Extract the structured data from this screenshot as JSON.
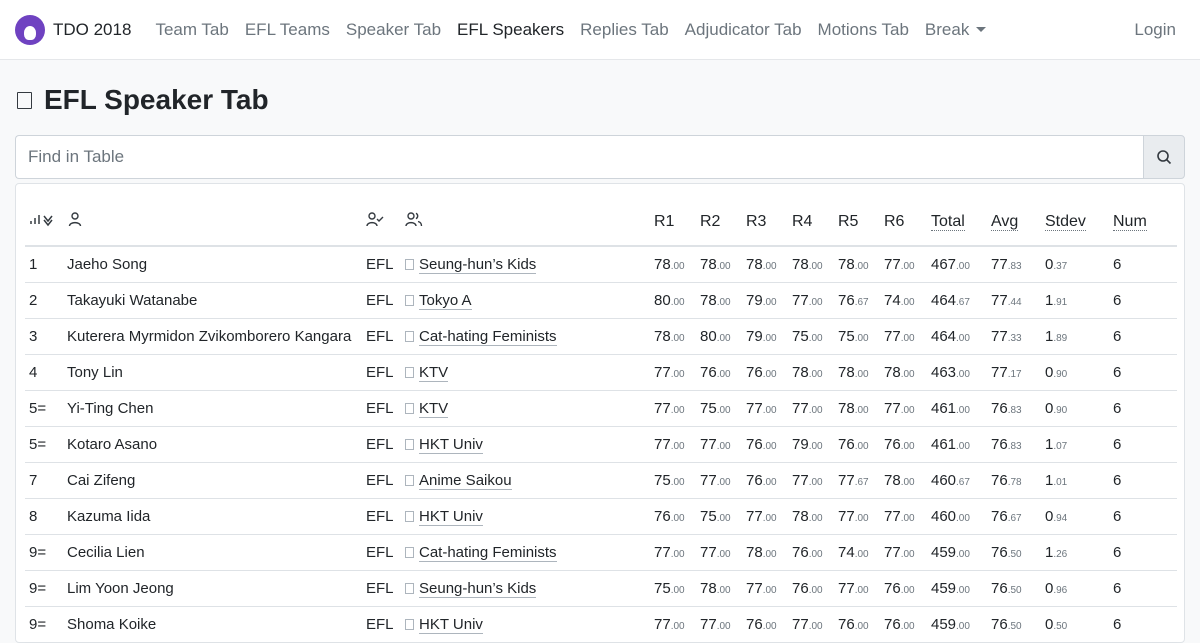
{
  "nav": {
    "brand": "TDO 2018",
    "items": [
      "Team Tab",
      "EFL Teams",
      "Speaker Tab",
      "EFL Speakers",
      "Replies Tab",
      "Adjudicator Tab",
      "Motions Tab",
      "Break"
    ],
    "active": "EFL Speakers",
    "login": "Login"
  },
  "page": {
    "title": "EFL Speaker Tab"
  },
  "search": {
    "placeholder": "Find in Table"
  },
  "table": {
    "headers": {
      "r1": "R1",
      "r2": "R2",
      "r3": "R3",
      "r4": "R4",
      "r5": "R5",
      "r6": "R6",
      "total": "Total",
      "avg": "Avg",
      "stdev": "Stdev",
      "num": "Num"
    },
    "rows": [
      {
        "rank": "1",
        "name": "Jaeho Song",
        "cat": "EFL",
        "team": "Seung-hun’s Kids",
        "scores": [
          [
            "78",
            ".00"
          ],
          [
            "78",
            ".00"
          ],
          [
            "78",
            ".00"
          ],
          [
            "78",
            ".00"
          ],
          [
            "78",
            ".00"
          ],
          [
            "77",
            ".00"
          ]
        ],
        "total": [
          "467",
          ".00"
        ],
        "avg": [
          "77",
          ".83"
        ],
        "stdev": [
          "0",
          ".37"
        ],
        "num": "6"
      },
      {
        "rank": "2",
        "name": "Takayuki Watanabe",
        "cat": "EFL",
        "team": "Tokyo A",
        "scores": [
          [
            "80",
            ".00"
          ],
          [
            "78",
            ".00"
          ],
          [
            "79",
            ".00"
          ],
          [
            "77",
            ".00"
          ],
          [
            "76",
            ".67"
          ],
          [
            "74",
            ".00"
          ]
        ],
        "total": [
          "464",
          ".67"
        ],
        "avg": [
          "77",
          ".44"
        ],
        "stdev": [
          "1",
          ".91"
        ],
        "num": "6"
      },
      {
        "rank": "3",
        "name": "Kuterera Myrmidon Zvikomborero Kangara",
        "cat": "EFL",
        "team": "Cat-hating Feminists",
        "scores": [
          [
            "78",
            ".00"
          ],
          [
            "80",
            ".00"
          ],
          [
            "79",
            ".00"
          ],
          [
            "75",
            ".00"
          ],
          [
            "75",
            ".00"
          ],
          [
            "77",
            ".00"
          ]
        ],
        "total": [
          "464",
          ".00"
        ],
        "avg": [
          "77",
          ".33"
        ],
        "stdev": [
          "1",
          ".89"
        ],
        "num": "6"
      },
      {
        "rank": "4",
        "name": "Tony Lin",
        "cat": "EFL",
        "team": "KTV",
        "scores": [
          [
            "77",
            ".00"
          ],
          [
            "76",
            ".00"
          ],
          [
            "76",
            ".00"
          ],
          [
            "78",
            ".00"
          ],
          [
            "78",
            ".00"
          ],
          [
            "78",
            ".00"
          ]
        ],
        "total": [
          "463",
          ".00"
        ],
        "avg": [
          "77",
          ".17"
        ],
        "stdev": [
          "0",
          ".90"
        ],
        "num": "6"
      },
      {
        "rank": "5=",
        "name": "Yi-Ting Chen",
        "cat": "EFL",
        "team": "KTV",
        "scores": [
          [
            "77",
            ".00"
          ],
          [
            "75",
            ".00"
          ],
          [
            "77",
            ".00"
          ],
          [
            "77",
            ".00"
          ],
          [
            "78",
            ".00"
          ],
          [
            "77",
            ".00"
          ]
        ],
        "total": [
          "461",
          ".00"
        ],
        "avg": [
          "76",
          ".83"
        ],
        "stdev": [
          "0",
          ".90"
        ],
        "num": "6"
      },
      {
        "rank": "5=",
        "name": "Kotaro Asano",
        "cat": "EFL",
        "team": "HKT Univ",
        "scores": [
          [
            "77",
            ".00"
          ],
          [
            "77",
            ".00"
          ],
          [
            "76",
            ".00"
          ],
          [
            "79",
            ".00"
          ],
          [
            "76",
            ".00"
          ],
          [
            "76",
            ".00"
          ]
        ],
        "total": [
          "461",
          ".00"
        ],
        "avg": [
          "76",
          ".83"
        ],
        "stdev": [
          "1",
          ".07"
        ],
        "num": "6"
      },
      {
        "rank": "7",
        "name": "Cai Zifeng",
        "cat": "EFL",
        "team": "Anime Saikou",
        "scores": [
          [
            "75",
            ".00"
          ],
          [
            "77",
            ".00"
          ],
          [
            "76",
            ".00"
          ],
          [
            "77",
            ".00"
          ],
          [
            "77",
            ".67"
          ],
          [
            "78",
            ".00"
          ]
        ],
        "total": [
          "460",
          ".67"
        ],
        "avg": [
          "76",
          ".78"
        ],
        "stdev": [
          "1",
          ".01"
        ],
        "num": "6"
      },
      {
        "rank": "8",
        "name": "Kazuma Iida",
        "cat": "EFL",
        "team": "HKT Univ",
        "scores": [
          [
            "76",
            ".00"
          ],
          [
            "75",
            ".00"
          ],
          [
            "77",
            ".00"
          ],
          [
            "78",
            ".00"
          ],
          [
            "77",
            ".00"
          ],
          [
            "77",
            ".00"
          ]
        ],
        "total": [
          "460",
          ".00"
        ],
        "avg": [
          "76",
          ".67"
        ],
        "stdev": [
          "0",
          ".94"
        ],
        "num": "6"
      },
      {
        "rank": "9=",
        "name": "Cecilia Lien",
        "cat": "EFL",
        "team": "Cat-hating Feminists",
        "scores": [
          [
            "77",
            ".00"
          ],
          [
            "77",
            ".00"
          ],
          [
            "78",
            ".00"
          ],
          [
            "76",
            ".00"
          ],
          [
            "74",
            ".00"
          ],
          [
            "77",
            ".00"
          ]
        ],
        "total": [
          "459",
          ".00"
        ],
        "avg": [
          "76",
          ".50"
        ],
        "stdev": [
          "1",
          ".26"
        ],
        "num": "6"
      },
      {
        "rank": "9=",
        "name": "Lim Yoon Jeong",
        "cat": "EFL",
        "team": "Seung-hun’s Kids",
        "scores": [
          [
            "75",
            ".00"
          ],
          [
            "78",
            ".00"
          ],
          [
            "77",
            ".00"
          ],
          [
            "76",
            ".00"
          ],
          [
            "77",
            ".00"
          ],
          [
            "76",
            ".00"
          ]
        ],
        "total": [
          "459",
          ".00"
        ],
        "avg": [
          "76",
          ".50"
        ],
        "stdev": [
          "0",
          ".96"
        ],
        "num": "6"
      },
      {
        "rank": "9=",
        "name": "Shoma Koike",
        "cat": "EFL",
        "team": "HKT Univ",
        "scores": [
          [
            "77",
            ".00"
          ],
          [
            "77",
            ".00"
          ],
          [
            "76",
            ".00"
          ],
          [
            "77",
            ".00"
          ],
          [
            "76",
            ".00"
          ],
          [
            "76",
            ".00"
          ]
        ],
        "total": [
          "459",
          ".00"
        ],
        "avg": [
          "76",
          ".50"
        ],
        "stdev": [
          "0",
          ".50"
        ],
        "num": "6"
      }
    ]
  }
}
